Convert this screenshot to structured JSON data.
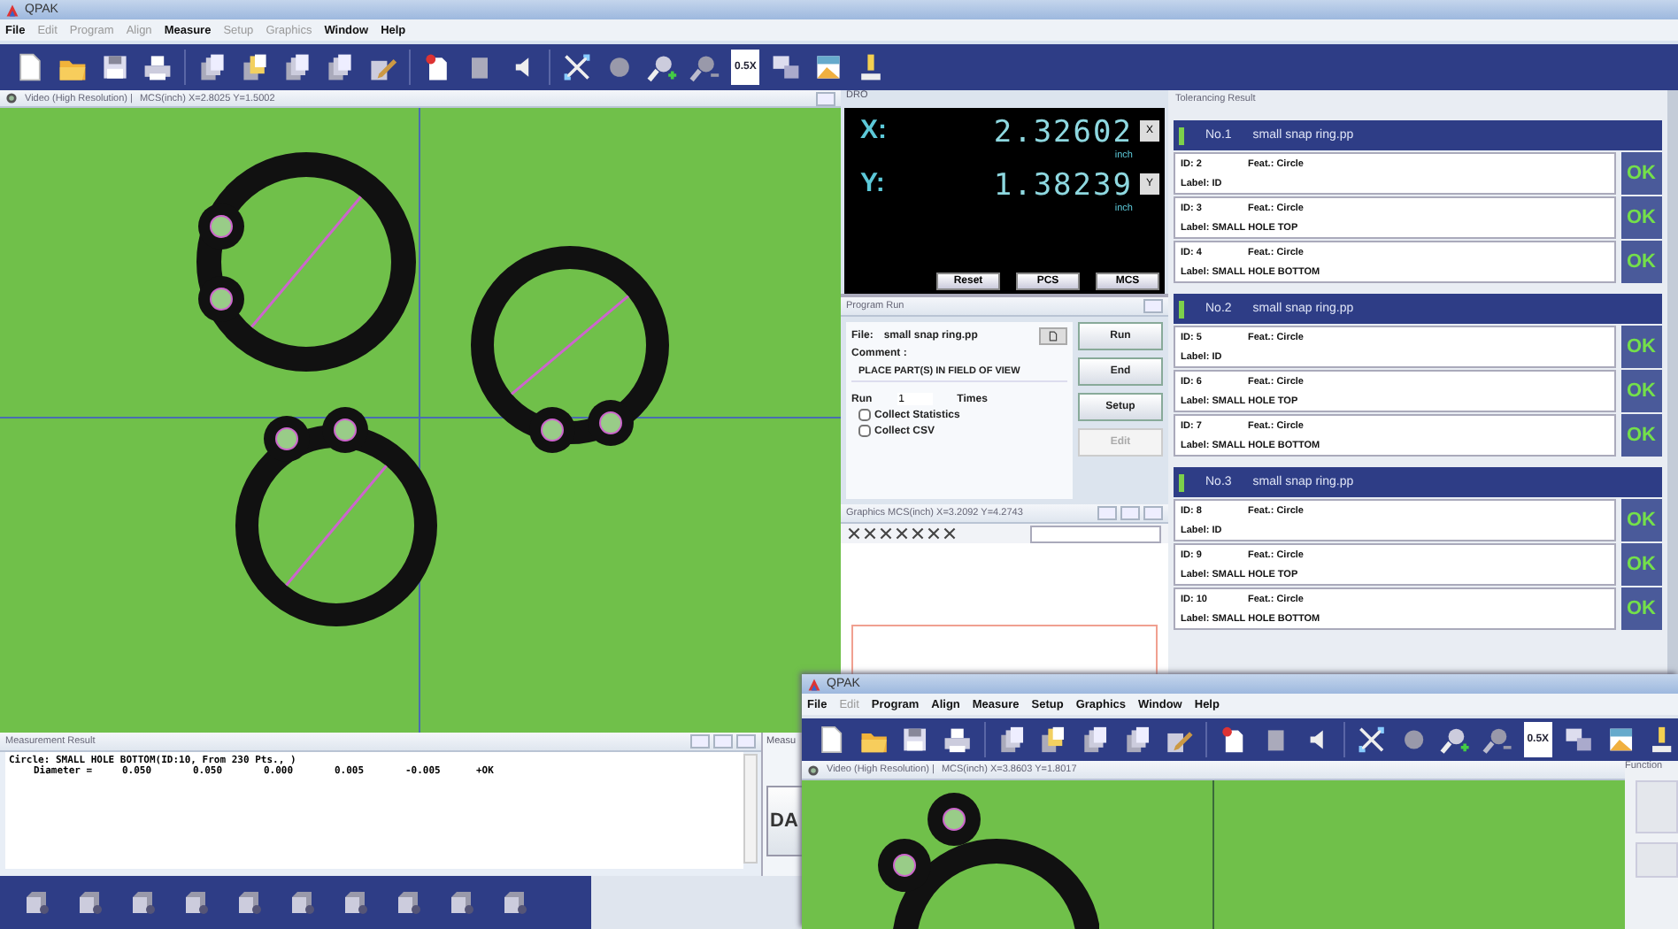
{
  "main_window": {
    "title": "QPAK",
    "menu": [
      {
        "label": "File",
        "disabled": false
      },
      {
        "label": "Edit",
        "disabled": true
      },
      {
        "label": "Program",
        "disabled": true
      },
      {
        "label": "Align",
        "disabled": true
      },
      {
        "label": "Measure",
        "disabled": false
      },
      {
        "label": "Setup",
        "disabled": true
      },
      {
        "label": "Graphics",
        "disabled": true
      },
      {
        "label": "Window",
        "disabled": false
      },
      {
        "label": "Help",
        "disabled": false
      }
    ],
    "zoom_label": "0.5X",
    "video": {
      "title": "Video (High Resolution) |",
      "coords": "MCS(inch) X=2.8025 Y=1.5002"
    },
    "dro": {
      "title": "DRO",
      "axes": [
        {
          "label": "X:",
          "value": "2.32602",
          "unit": "inch",
          "button": "X"
        },
        {
          "label": "Y:",
          "value": "1.38239",
          "unit": "inch",
          "button": "Y"
        }
      ],
      "buttons": [
        "Reset",
        "PCS",
        "MCS"
      ]
    },
    "program_run": {
      "title": "Program Run",
      "file_label": "File:",
      "file": "small snap ring.pp",
      "comment_label": "Comment :",
      "comment": "PLACE PART(S) IN FIELD OF VIEW",
      "run_label": "Run",
      "run_count": "1",
      "times_label": "Times",
      "checkboxes": [
        {
          "label": "Collect Statistics",
          "checked": false
        },
        {
          "label": "Collect CSV",
          "checked": false
        }
      ],
      "buttons": [
        {
          "label": "Run",
          "disabled": false
        },
        {
          "label": "End",
          "disabled": false
        },
        {
          "label": "Setup",
          "disabled": false
        },
        {
          "label": "Edit",
          "disabled": true
        }
      ]
    },
    "graphics": {
      "title": "Graphics  MCS(inch) X=3.2092 Y=4.2743"
    },
    "tolerancing": {
      "title": "Tolerancing Result",
      "groups": [
        {
          "number": "No.1",
          "program": "small snap ring.pp",
          "results": [
            {
              "id": "ID: 2",
              "feature": "Feat.: Circle",
              "label": "Label: ID",
              "status": "OK"
            },
            {
              "id": "ID: 3",
              "feature": "Feat.: Circle",
              "label": "Label: SMALL HOLE TOP",
              "status": "OK"
            },
            {
              "id": "ID: 4",
              "feature": "Feat.: Circle",
              "label": "Label: SMALL HOLE BOTTOM",
              "status": "OK"
            }
          ]
        },
        {
          "number": "No.2",
          "program": "small snap ring.pp",
          "results": [
            {
              "id": "ID: 5",
              "feature": "Feat.: Circle",
              "label": "Label: ID",
              "status": "OK"
            },
            {
              "id": "ID: 6",
              "feature": "Feat.: Circle",
              "label": "Label: SMALL HOLE TOP",
              "status": "OK"
            },
            {
              "id": "ID: 7",
              "feature": "Feat.: Circle",
              "label": "Label: SMALL HOLE BOTTOM",
              "status": "OK"
            }
          ]
        },
        {
          "number": "No.3",
          "program": "small snap ring.pp",
          "results": [
            {
              "id": "ID: 8",
              "feature": "Feat.: Circle",
              "label": "Label: ID",
              "status": "OK"
            },
            {
              "id": "ID: 9",
              "feature": "Feat.: Circle",
              "label": "Label: SMALL HOLE TOP",
              "status": "OK"
            },
            {
              "id": "ID: 10",
              "feature": "Feat.: Circle",
              "label": "Label: SMALL HOLE BOTTOM",
              "status": "OK"
            }
          ]
        }
      ]
    },
    "measurement": {
      "title": "Measurement Result",
      "heading": "Circle: SMALL HOLE BOTTOM(ID:10, From 230 Pts.,  )",
      "row": [
        "Diameter =",
        "0.050",
        "0.050",
        "0.000",
        "0.005",
        "-0.005",
        "+OK"
      ]
    },
    "measure_panel": {
      "title": "Measu",
      "button": "DA"
    }
  },
  "second_window": {
    "title": "QPAK",
    "menu": [
      {
        "label": "File",
        "disabled": false
      },
      {
        "label": "Edit",
        "disabled": true
      },
      {
        "label": "Program",
        "disabled": false
      },
      {
        "label": "Align",
        "disabled": false
      },
      {
        "label": "Measure",
        "disabled": false
      },
      {
        "label": "Setup",
        "disabled": false
      },
      {
        "label": "Graphics",
        "disabled": false
      },
      {
        "label": "Window",
        "disabled": false
      },
      {
        "label": "Help",
        "disabled": false
      }
    ],
    "zoom_label": "0.5X",
    "video": {
      "title": "Video (High Resolution) |",
      "coords": "MCS(inch) X=3.8603 Y=1.8017"
    },
    "function_panel": {
      "title": "Function"
    }
  }
}
